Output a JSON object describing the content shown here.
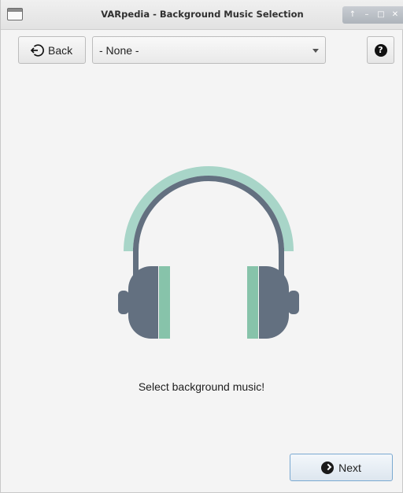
{
  "window": {
    "title": "VARpedia - Background Music Selection",
    "controls": {
      "up": "↑",
      "minimize": "–",
      "maximize": "□",
      "close": "✕"
    }
  },
  "toolbar": {
    "back_label": "Back",
    "back_icon": "back-arrow-circle-icon",
    "music_select": {
      "selected": "- None -"
    },
    "help_icon": "question-circle-icon",
    "help_glyph": "?"
  },
  "main": {
    "illustration": "headphones-icon",
    "message": "Select background music!",
    "colors": {
      "band_outer": "#a8d5c8",
      "body": "#637080",
      "cushion": "#87c3aa"
    }
  },
  "footer": {
    "next_label": "Next",
    "next_icon": "chevron-right-circle-icon"
  }
}
